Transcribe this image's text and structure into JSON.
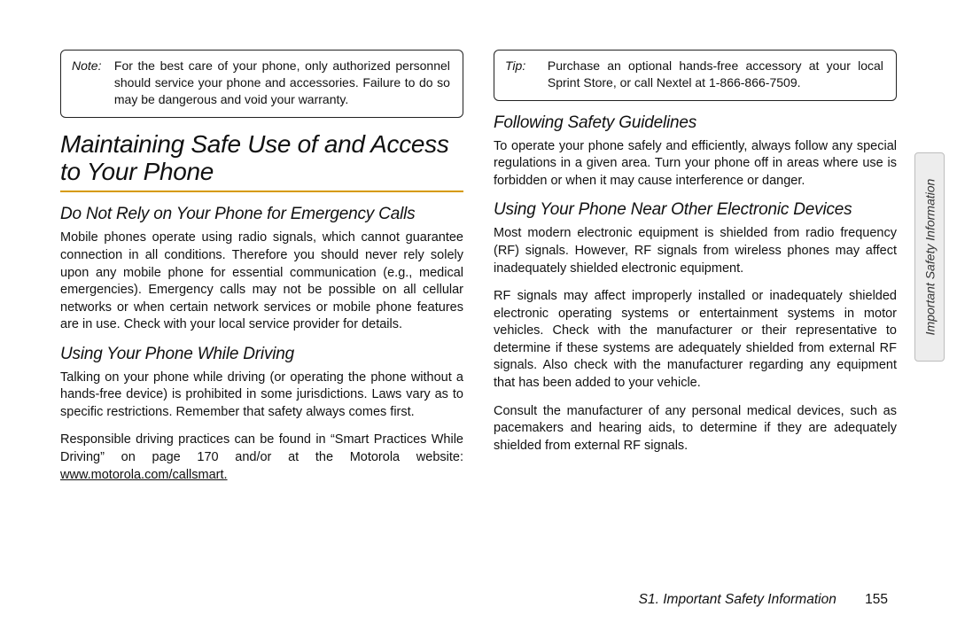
{
  "left": {
    "note": {
      "label": "Note:",
      "body": "For the best care of your phone, only authorized personnel should service your phone and accessories. Failure to do so may be dangerous and void your warranty."
    },
    "h1": "Maintaining Safe Use of and Access to Your Phone",
    "sec1": {
      "heading": "Do Not Rely on Your Phone for Emergency Calls",
      "p1": "Mobile phones operate using radio signals, which cannot guarantee connection in all conditions. Therefore you should never rely solely upon any mobile phone for essential communication (e.g., medical emergencies). Emergency calls may not be possible on all cellular networks or when certain network services or mobile phone features are in use. Check with your local service provider for details."
    },
    "sec2": {
      "heading": "Using Your Phone While Driving",
      "p1": "Talking on your phone while driving (or operating the phone without a hands-free device) is prohibited in some jurisdictions. Laws vary as to specific restrictions. Remember that safety always comes first.",
      "p2a": "Responsible driving practices can be found in “Smart Practices While Driving” on page 170 and/or at the Motorola website: ",
      "link": "www.motorola.com/callsmart.",
      "p2b": ""
    }
  },
  "right": {
    "tip": {
      "label": "Tip:",
      "body": "Purchase an optional hands-free accessory at your local Sprint Store, or call Nextel at 1-866-866-7509."
    },
    "sec1": {
      "heading": "Following Safety Guidelines",
      "p1": "To operate your phone safely and efficiently, always follow any special regulations in a given area. Turn your phone off in areas where use is forbidden or when it may cause interference or danger."
    },
    "sec2": {
      "heading": "Using Your Phone Near Other Electronic Devices",
      "p1": "Most modern electronic equipment is shielded from radio frequency (RF) signals. However, RF signals from wireless phones may affect inadequately shielded electronic equipment.",
      "p2": "RF signals may affect improperly installed or inadequately shielded electronic operating systems or entertainment systems in motor vehicles. Check with the manufacturer or their representative to determine if these systems are adequately shielded from external RF signals. Also check with the manufacturer regarding any equipment that has been added to your vehicle.",
      "p3": "Consult the manufacturer of any personal medical devices, such as pacemakers and hearing aids, to determine if they are adequately shielded from external RF signals."
    }
  },
  "footer": {
    "section": "S1. Important Safety Information",
    "page": "155"
  },
  "sidetab": "Important Safety Information"
}
